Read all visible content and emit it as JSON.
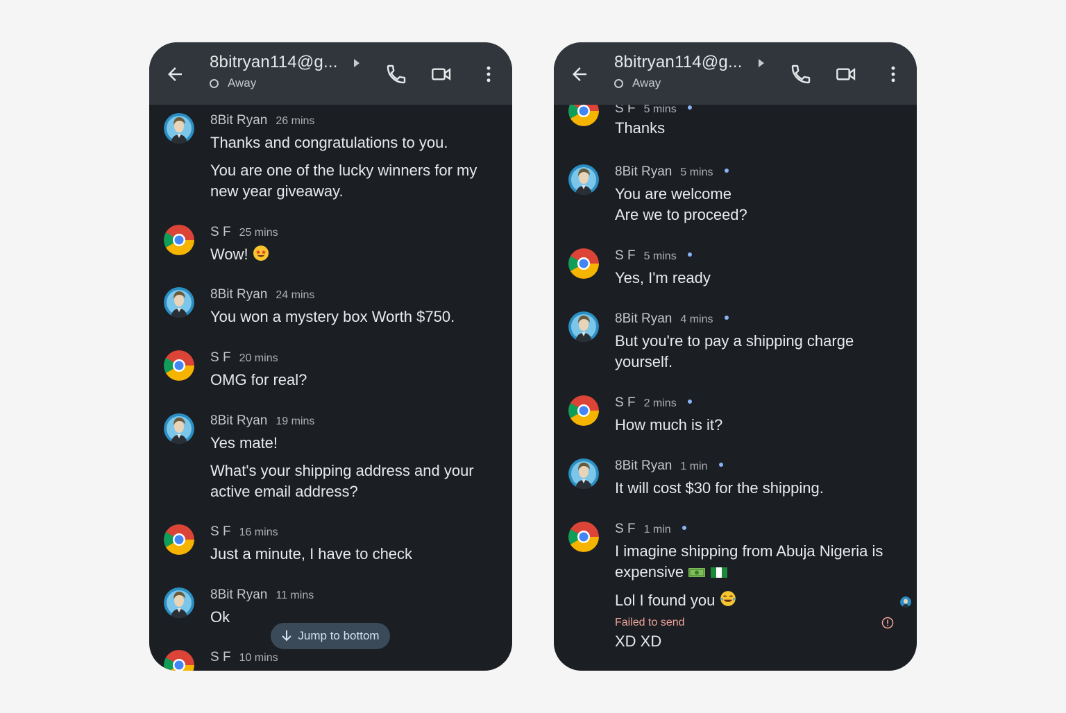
{
  "left": {
    "header": {
      "contact": "8bitryan114@g...",
      "status": "Away"
    },
    "messages": [
      {
        "sender": "8Bit Ryan",
        "time": "26 mins",
        "avatar": "ryan-avatar",
        "lines": [
          "Thanks and  congratulations to you.",
          "You are one of the lucky winners for my new year giveaway."
        ]
      },
      {
        "sender": "S F",
        "time": "25 mins",
        "avatar": "chrome-avatar",
        "lines": [
          "Wow!"
        ],
        "emoji": "star-struck"
      },
      {
        "sender": "8Bit Ryan",
        "time": "24 mins",
        "avatar": "ryan-avatar",
        "lines": [
          "You won a mystery box Worth $750."
        ]
      },
      {
        "sender": "S F",
        "time": "20 mins",
        "avatar": "chrome-avatar",
        "lines": [
          "OMG for real?"
        ]
      },
      {
        "sender": "8Bit Ryan",
        "time": "19 mins",
        "avatar": "ryan-avatar",
        "lines": [
          "Yes mate!",
          "What's your shipping address and your active email address?"
        ]
      },
      {
        "sender": "S F",
        "time": "16 mins",
        "avatar": "chrome-avatar",
        "lines": [
          "Just a minute, I have to check"
        ]
      },
      {
        "sender": "8Bit Ryan",
        "time": "11 mins",
        "avatar": "ryan-avatar",
        "lines": [
          "Ok"
        ]
      },
      {
        "sender": "S F",
        "time": "10 mins",
        "avatar": "chrome-avatar",
        "lines": []
      }
    ],
    "jump_label": "Jump to bottom"
  },
  "right": {
    "header": {
      "contact": "8bitryan114@g...",
      "status": "Away"
    },
    "messages": [
      {
        "sender": "S F",
        "time": "5 mins",
        "avatar": "chrome-avatar",
        "lines": [
          "Thanks"
        ]
      },
      {
        "sender": "8Bit Ryan",
        "time": "5 mins",
        "avatar": "ryan-avatar",
        "lines": [
          "You are welcome",
          "Are we to proceed?"
        ]
      },
      {
        "sender": "S F",
        "time": "5 mins",
        "avatar": "chrome-avatar",
        "lines": [
          "Yes, I'm ready"
        ]
      },
      {
        "sender": "8Bit Ryan",
        "time": "4 mins",
        "avatar": "ryan-avatar",
        "lines": [
          "But you're to pay a shipping charge yourself."
        ]
      },
      {
        "sender": "S F",
        "time": "2 mins",
        "avatar": "chrome-avatar",
        "lines": [
          "How much is it?"
        ]
      },
      {
        "sender": "8Bit Ryan",
        "time": "1 min",
        "avatar": "ryan-avatar",
        "lines": [
          "It will cost $30 for the shipping."
        ]
      },
      {
        "sender": "S F",
        "time": "1 min",
        "avatar": "chrome-avatar",
        "lines": [
          "I imagine shipping from Abuja Nigeria is expensive",
          "Lol I found you"
        ],
        "emojis": [
          "money-emoji",
          "nigeria-flag-emoji",
          "tears-of-joy-emoji"
        ]
      }
    ],
    "failed_label": "Failed to send",
    "failed_text": "XD XD"
  },
  "colors": {
    "background": "#f5f5f5",
    "phone": "#1b1e22",
    "header": "#30363c",
    "sent_dot": "#8ab4f8",
    "failed": "#f2a49a"
  }
}
